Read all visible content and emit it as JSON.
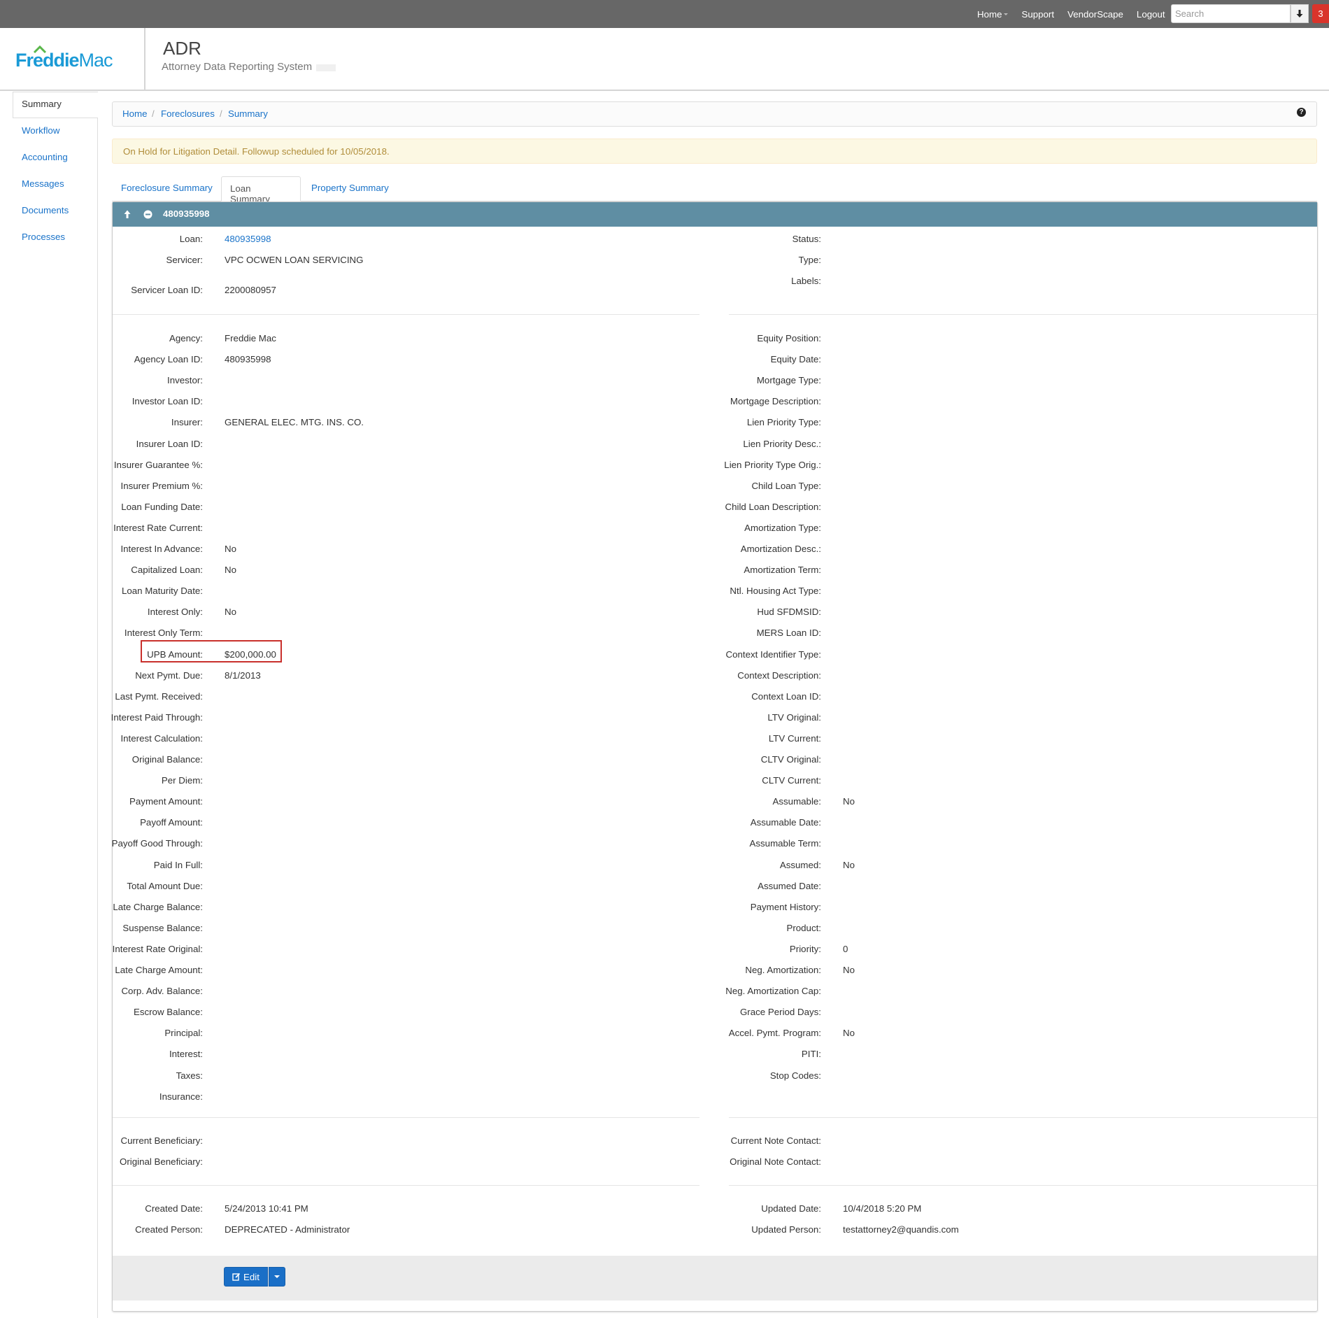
{
  "topnav": {
    "home": "Home",
    "support": "Support",
    "vendorscape": "VendorScape",
    "logout": "Logout",
    "search_placeholder": "Search",
    "notification_count": "3"
  },
  "header": {
    "logo_text_1": "Freddie",
    "logo_text_2": "Mac",
    "app_title": "ADR",
    "app_subtitle": "Attorney Data Reporting System"
  },
  "sidebar": {
    "items": [
      {
        "label": "Summary"
      },
      {
        "label": "Workflow"
      },
      {
        "label": "Accounting"
      },
      {
        "label": "Messages"
      },
      {
        "label": "Documents"
      },
      {
        "label": "Processes"
      }
    ]
  },
  "breadcrumb": {
    "home": "Home",
    "foreclosures": "Foreclosures",
    "summary": "Summary",
    "sep": "/"
  },
  "alert": {
    "text": "On Hold for Litigation Detail. Followup scheduled for 10/05/2018."
  },
  "tabs": {
    "foreclosure_summary": "Foreclosure Summary",
    "loan_summary": "Loan Summary",
    "property_summary": "Property Summary"
  },
  "panel": {
    "title": "480935998",
    "edit_label": "Edit",
    "left_top": [
      {
        "label": "Loan:",
        "value": "480935998"
      },
      {
        "label": "Servicer:",
        "value": "VPC OCWEN LOAN SERVICING"
      },
      {
        "label": "Servicer Loan ID:",
        "value": "2200080957"
      }
    ],
    "right_top": [
      {
        "label": "Status:",
        "value": ""
      },
      {
        "label": "Type:",
        "value": ""
      },
      {
        "label": "Labels:",
        "value": ""
      }
    ],
    "left_main": [
      {
        "label": "Agency:",
        "value": "Freddie Mac"
      },
      {
        "label": "Agency Loan ID:",
        "value": "480935998"
      },
      {
        "label": "Investor:",
        "value": ""
      },
      {
        "label": "Investor Loan ID:",
        "value": ""
      },
      {
        "label": "Insurer:",
        "value": "GENERAL ELEC. MTG. INS. CO."
      },
      {
        "label": "Insurer Loan ID:",
        "value": ""
      },
      {
        "label": "Insurer Guarantee %:",
        "value": ""
      },
      {
        "label": "Insurer Premium %:",
        "value": ""
      },
      {
        "label": "Loan Funding Date:",
        "value": ""
      },
      {
        "label": "Interest Rate Current:",
        "value": ""
      },
      {
        "label": "Interest In Advance:",
        "value": "No"
      },
      {
        "label": "Capitalized Loan:",
        "value": "No"
      },
      {
        "label": "Loan Maturity Date:",
        "value": ""
      },
      {
        "label": "Interest Only:",
        "value": "No"
      },
      {
        "label": "Interest Only Term:",
        "value": ""
      },
      {
        "label": "UPB Amount:",
        "value": "$200,000.00"
      },
      {
        "label": "Next Pymt. Due:",
        "value": "8/1/2013"
      },
      {
        "label": "Last Pymt. Received:",
        "value": ""
      },
      {
        "label": "Interest Paid Through:",
        "value": ""
      },
      {
        "label": "Interest Calculation:",
        "value": ""
      },
      {
        "label": "Original Balance:",
        "value": ""
      },
      {
        "label": "Per Diem:",
        "value": ""
      },
      {
        "label": "Payment Amount:",
        "value": ""
      },
      {
        "label": "Payoff Amount:",
        "value": ""
      },
      {
        "label": "Payoff Good Through:",
        "value": ""
      },
      {
        "label": "Paid In Full:",
        "value": ""
      },
      {
        "label": "Total Amount Due:",
        "value": ""
      },
      {
        "label": "Late Charge Balance:",
        "value": ""
      },
      {
        "label": "Suspense Balance:",
        "value": ""
      },
      {
        "label": "Interest Rate Original:",
        "value": ""
      },
      {
        "label": "Late Charge Amount:",
        "value": ""
      },
      {
        "label": "Corp. Adv. Balance:",
        "value": ""
      },
      {
        "label": "Escrow Balance:",
        "value": ""
      },
      {
        "label": "Principal:",
        "value": ""
      },
      {
        "label": "Interest:",
        "value": ""
      },
      {
        "label": "Taxes:",
        "value": ""
      },
      {
        "label": "Insurance:",
        "value": ""
      }
    ],
    "right_main": [
      {
        "label": "Equity Position:",
        "value": ""
      },
      {
        "label": "Equity Date:",
        "value": ""
      },
      {
        "label": "Mortgage Type:",
        "value": ""
      },
      {
        "label": "Mortgage Description:",
        "value": ""
      },
      {
        "label": "Lien Priority Type:",
        "value": ""
      },
      {
        "label": "Lien Priority Desc.:",
        "value": ""
      },
      {
        "label": "Lien Priority Type Orig.:",
        "value": ""
      },
      {
        "label": "Child Loan Type:",
        "value": ""
      },
      {
        "label": "Child Loan Description:",
        "value": ""
      },
      {
        "label": "Amortization Type:",
        "value": ""
      },
      {
        "label": "Amortization Desc.:",
        "value": ""
      },
      {
        "label": "Amortization Term:",
        "value": ""
      },
      {
        "label": "Ntl. Housing Act Type:",
        "value": ""
      },
      {
        "label": "Hud SFDMSID:",
        "value": ""
      },
      {
        "label": "MERS Loan ID:",
        "value": ""
      },
      {
        "label": "Context Identifier Type:",
        "value": ""
      },
      {
        "label": "Context Description:",
        "value": ""
      },
      {
        "label": "Context Loan ID:",
        "value": ""
      },
      {
        "label": "LTV Original:",
        "value": ""
      },
      {
        "label": "LTV Current:",
        "value": ""
      },
      {
        "label": "CLTV Original:",
        "value": ""
      },
      {
        "label": "CLTV Current:",
        "value": ""
      },
      {
        "label": "Assumable:",
        "value": "No"
      },
      {
        "label": "Assumable Date:",
        "value": ""
      },
      {
        "label": "Assumable Term:",
        "value": ""
      },
      {
        "label": "Assumed:",
        "value": "No"
      },
      {
        "label": "Assumed Date:",
        "value": ""
      },
      {
        "label": "Payment History:",
        "value": ""
      },
      {
        "label": "Product:",
        "value": ""
      },
      {
        "label": "Priority:",
        "value": "0"
      },
      {
        "label": "Neg. Amortization:",
        "value": "No"
      },
      {
        "label": "Neg. Amortization Cap:",
        "value": ""
      },
      {
        "label": "Grace Period Days:",
        "value": ""
      },
      {
        "label": "Accel. Pymt. Program:",
        "value": "No"
      },
      {
        "label": "PITI:",
        "value": ""
      },
      {
        "label": "Stop Codes:",
        "value": ""
      }
    ],
    "left_bene": [
      {
        "label": "Current Beneficiary:",
        "value": ""
      },
      {
        "label": "Original Beneficiary:",
        "value": ""
      }
    ],
    "right_bene": [
      {
        "label": "Current Note Contact:",
        "value": ""
      },
      {
        "label": "Original Note Contact:",
        "value": ""
      }
    ],
    "left_audit": [
      {
        "label": "Created Date:",
        "value": "5/24/2013 10:41 PM"
      },
      {
        "label": "Created Person:",
        "value": "DEPRECATED - Administrator"
      }
    ],
    "right_audit": [
      {
        "label": "Updated Date:",
        "value": "10/4/2018 5:20 PM"
      },
      {
        "label": "Updated Person:",
        "value": "testattorney2@quandis.com"
      }
    ]
  }
}
